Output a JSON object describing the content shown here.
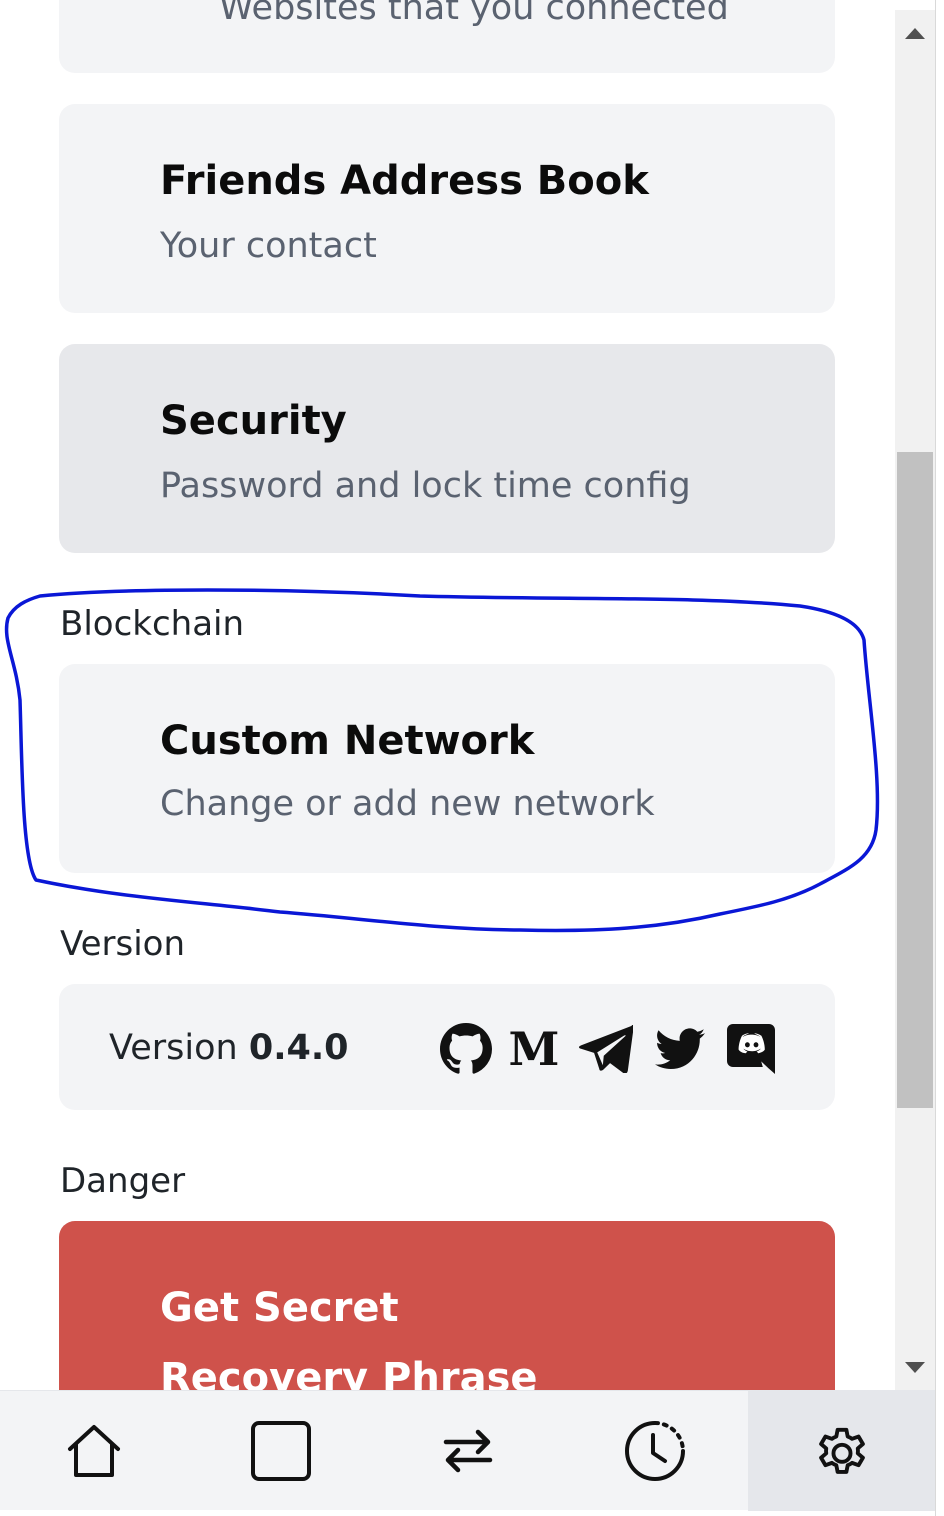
{
  "settings": {
    "connected_sites": {
      "desc": "Websites that you connected"
    },
    "address_book": {
      "title": "Friends Address Book",
      "desc": "Your contact"
    },
    "security": {
      "title": "Security",
      "desc": "Password and lock time config"
    },
    "blockchain": {
      "section": "Blockchain",
      "custom_network": {
        "title": "Custom Network",
        "desc": "Change or add new network"
      }
    },
    "version": {
      "section": "Version",
      "label": "Version",
      "number": "0.4.0",
      "socials": [
        "github-icon",
        "medium-icon",
        "telegram-icon",
        "twitter-icon",
        "discord-icon"
      ]
    },
    "danger": {
      "section": "Danger",
      "recovery_phrase": "Get Secret Recovery Phrase"
    }
  },
  "nav": {
    "items": [
      "home-icon",
      "square-icon",
      "swap-icon",
      "history-icon",
      "settings-icon"
    ],
    "active": "settings-icon"
  },
  "colors": {
    "card": "#f3f4f6",
    "card_hover": "#e7e8eb",
    "danger": "#cf524b",
    "annotation": "#0a17d6"
  }
}
